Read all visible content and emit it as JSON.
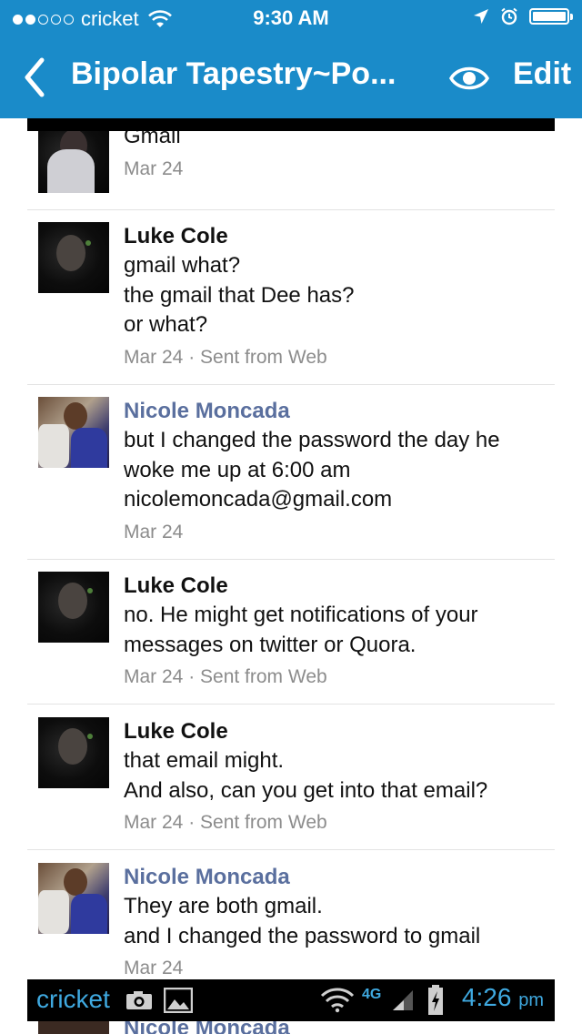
{
  "status_bar": {
    "carrier": "cricket",
    "time": "9:30 AM"
  },
  "nav": {
    "title": "Bipolar Tapestry~Po...",
    "edit_label": "Edit"
  },
  "messages": [
    {
      "sender": "",
      "sender_style": "luke",
      "lines": [
        "Gmail"
      ],
      "meta": "Mar 24"
    },
    {
      "sender": "Luke Cole",
      "sender_style": "luke",
      "lines": [
        "gmail what?",
        "the gmail that Dee has?",
        "or what?"
      ],
      "meta": "Mar 24 · Sent from Web"
    },
    {
      "sender": "Nicole Moncada",
      "sender_style": "nicole",
      "lines": [
        "but I changed the password the day he",
        "woke me up at 6:00 am",
        "nicolemoncada@gmail.com"
      ],
      "meta": "Mar 24"
    },
    {
      "sender": "Luke Cole",
      "sender_style": "luke",
      "lines": [
        "no. He might get notifications of your",
        "messages on twitter or Quora."
      ],
      "meta": "Mar 24 · Sent from Web"
    },
    {
      "sender": "Luke Cole",
      "sender_style": "luke",
      "lines": [
        "that email might.",
        "And also, can you get into that email?"
      ],
      "meta": "Mar 24 · Sent from Web"
    },
    {
      "sender": "Nicole Moncada",
      "sender_style": "nicole",
      "lines": [
        "They are both gmail.",
        "and I changed the password to gmail"
      ],
      "meta": "Mar 24"
    }
  ],
  "android_bar": {
    "carrier": "cricket",
    "network": "4G",
    "time": "4:26",
    "ampm": "pm"
  },
  "peek_sender": "Nicole Moncada",
  "colors": {
    "nav_background": "#1a8bc9",
    "nicole_name": "#5a6f9e",
    "meta_text": "#8c8c8c",
    "android_accent": "#3fa9e0"
  }
}
